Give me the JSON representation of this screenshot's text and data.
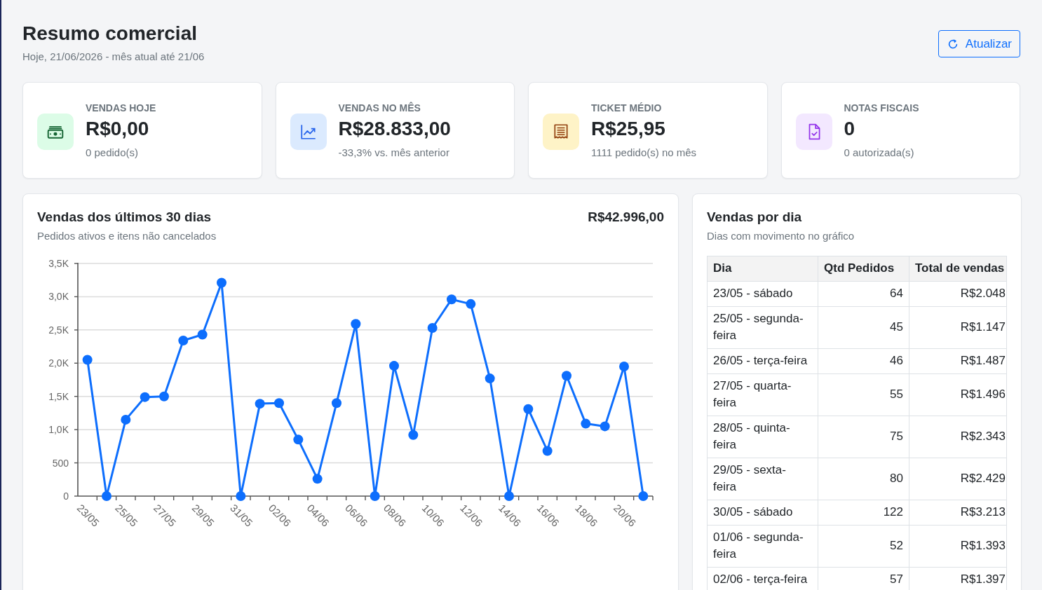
{
  "header": {
    "title": "Resumo comercial",
    "subtitle": "Hoje, 21/06/2026 - mês atual até 21/06",
    "refresh_button": "Atualizar"
  },
  "stat_cards": [
    {
      "kind": "today",
      "label": "VENDAS HOJE",
      "value": "R$0,00",
      "detail": "0 pedido(s)"
    },
    {
      "kind": "month",
      "label": "VENDAS NO MÊS",
      "value": "R$28.833,00",
      "detail": "-33,3% vs. mês anterior"
    },
    {
      "kind": "ticket",
      "label": "TICKET MÉDIO",
      "value": "R$25,95",
      "detail": "1111 pedido(s) no mês"
    },
    {
      "kind": "invoices",
      "label": "NOTAS FISCAIS",
      "value": "0",
      "detail": "0 autorizada(s)"
    }
  ],
  "sales_chart": {
    "title": "Vendas dos últimos 30 dias",
    "subtitle": "Pedidos ativos e itens não cancelados",
    "total": "R$42.996,00",
    "chart_data": {
      "type": "line",
      "categories": [
        "23/05",
        null,
        "25/05",
        null,
        "27/05",
        null,
        "29/05",
        null,
        "31/05",
        null,
        "02/06",
        null,
        "04/06",
        null,
        "06/06",
        null,
        "08/06",
        null,
        "10/06",
        null,
        "12/06",
        null,
        "14/06",
        null,
        "16/06",
        null,
        "18/06",
        null,
        "20/06",
        null
      ],
      "values": [
        2050,
        0,
        1150,
        1490,
        1500,
        2340,
        2430,
        3210,
        0,
        1390,
        1400,
        850,
        260,
        1400,
        2590,
        0,
        1960,
        920,
        2530,
        2960,
        2890,
        1770,
        0,
        1310,
        680,
        1810,
        1090,
        1050,
        1950,
        0
      ],
      "ylim": [
        0,
        3500
      ],
      "yticks": [
        {
          "value": 0,
          "label": "0"
        },
        {
          "value": 500,
          "label": "500"
        },
        {
          "value": 1000,
          "label": "1,0K"
        },
        {
          "value": 1500,
          "label": "1,5K"
        },
        {
          "value": 2000,
          "label": "2,0K"
        },
        {
          "value": 2500,
          "label": "2,5K"
        },
        {
          "value": 3000,
          "label": "3,0K"
        },
        {
          "value": 3500,
          "label": "3,5K"
        }
      ],
      "grid": true,
      "marker": "circle"
    }
  },
  "daily_sales": {
    "title": "Vendas por dia",
    "subtitle": "Dias com movimento no gráfico",
    "table": {
      "columns": [
        "Dia",
        "Qtd Pedidos",
        "Total de vendas"
      ],
      "rows": [
        [
          "23/05 - sábado",
          "64",
          "R$2.048"
        ],
        [
          "25/05 - segunda-feira",
          "45",
          "R$1.147"
        ],
        [
          "26/05 - terça-feira",
          "46",
          "R$1.487"
        ],
        [
          "27/05 - quarta-feira",
          "55",
          "R$1.496"
        ],
        [
          "28/05 - quinta-feira",
          "75",
          "R$2.343"
        ],
        [
          "29/05 - sexta-feira",
          "80",
          "R$2.429"
        ],
        [
          "30/05 - sábado",
          "122",
          "R$3.213"
        ],
        [
          "01/06 - segunda-feira",
          "52",
          "R$1.393"
        ],
        [
          "02/06 - terça-feira",
          "57",
          "R$1.397"
        ]
      ]
    }
  }
}
